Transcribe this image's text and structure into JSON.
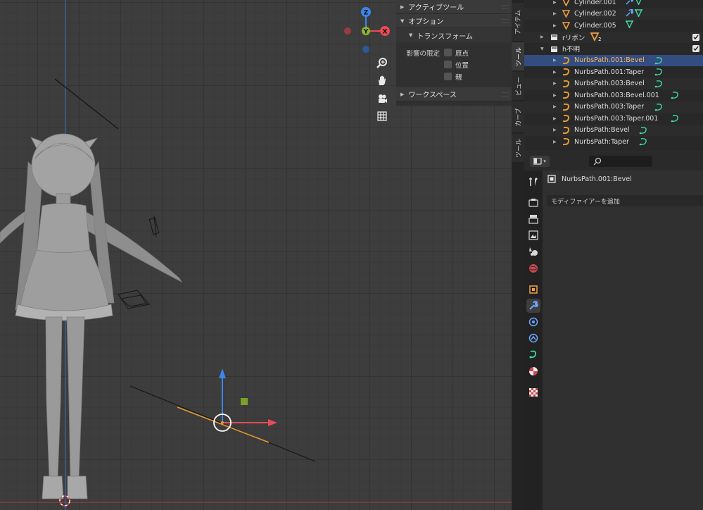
{
  "app": "Blender",
  "colors": {
    "selected_row": "#334d80",
    "curve_orange": "#e39933",
    "mesh_orange": "#f0a040",
    "modifier_green": "#3fd8a5",
    "axis_x": "#e94b57",
    "axis_y": "#8bb62b",
    "axis_z": "#3b86e8"
  },
  "gizmo": {
    "z": "Z",
    "y": "Y",
    "x": "X"
  },
  "npanel": {
    "active_tool": "アクティブツール",
    "options": "オプション",
    "transform": "トランスフォーム",
    "limit_label": "影響の限定",
    "checks": [
      "原点",
      "位置",
      "親"
    ],
    "workspace": "ワークスペース"
  },
  "vtabs": [
    "アイテム",
    "ツール",
    "ビュー",
    "カーブ",
    "ツール"
  ],
  "outliner": {
    "rows": [
      {
        "name": "Cylinder.001",
        "type": "mesh",
        "subs": [
          "wrench",
          "mesh"
        ]
      },
      {
        "name": "Cylinder.002",
        "type": "mesh",
        "subs": [
          "wrench",
          "mesh"
        ]
      },
      {
        "name": "Cylinder.005",
        "type": "mesh",
        "subs": [
          "mesh"
        ]
      },
      {
        "name": "rリボン",
        "type": "collection",
        "badge": "2"
      },
      {
        "name": "h不明",
        "type": "collection"
      },
      {
        "name": "NurbsPath.001:Bevel",
        "type": "curve",
        "selected": true
      },
      {
        "name": "NurbsPath.001:Taper",
        "type": "curve"
      },
      {
        "name": "NurbsPath.003:Bevel",
        "type": "curve"
      },
      {
        "name": "NurbsPath.003:Bevel.001",
        "type": "curve"
      },
      {
        "name": "NurbsPath.003:Taper",
        "type": "curve"
      },
      {
        "name": "NurbsPath.003:Taper.001",
        "type": "curve"
      },
      {
        "name": "NurbsPath:Bevel",
        "type": "curve"
      },
      {
        "name": "NurbsPath:Taper",
        "type": "curve"
      }
    ]
  },
  "properties": {
    "object_name": "NurbsPath.001:Bevel",
    "add_modifier": "モディファイアーを追加",
    "search_placeholder": ""
  }
}
